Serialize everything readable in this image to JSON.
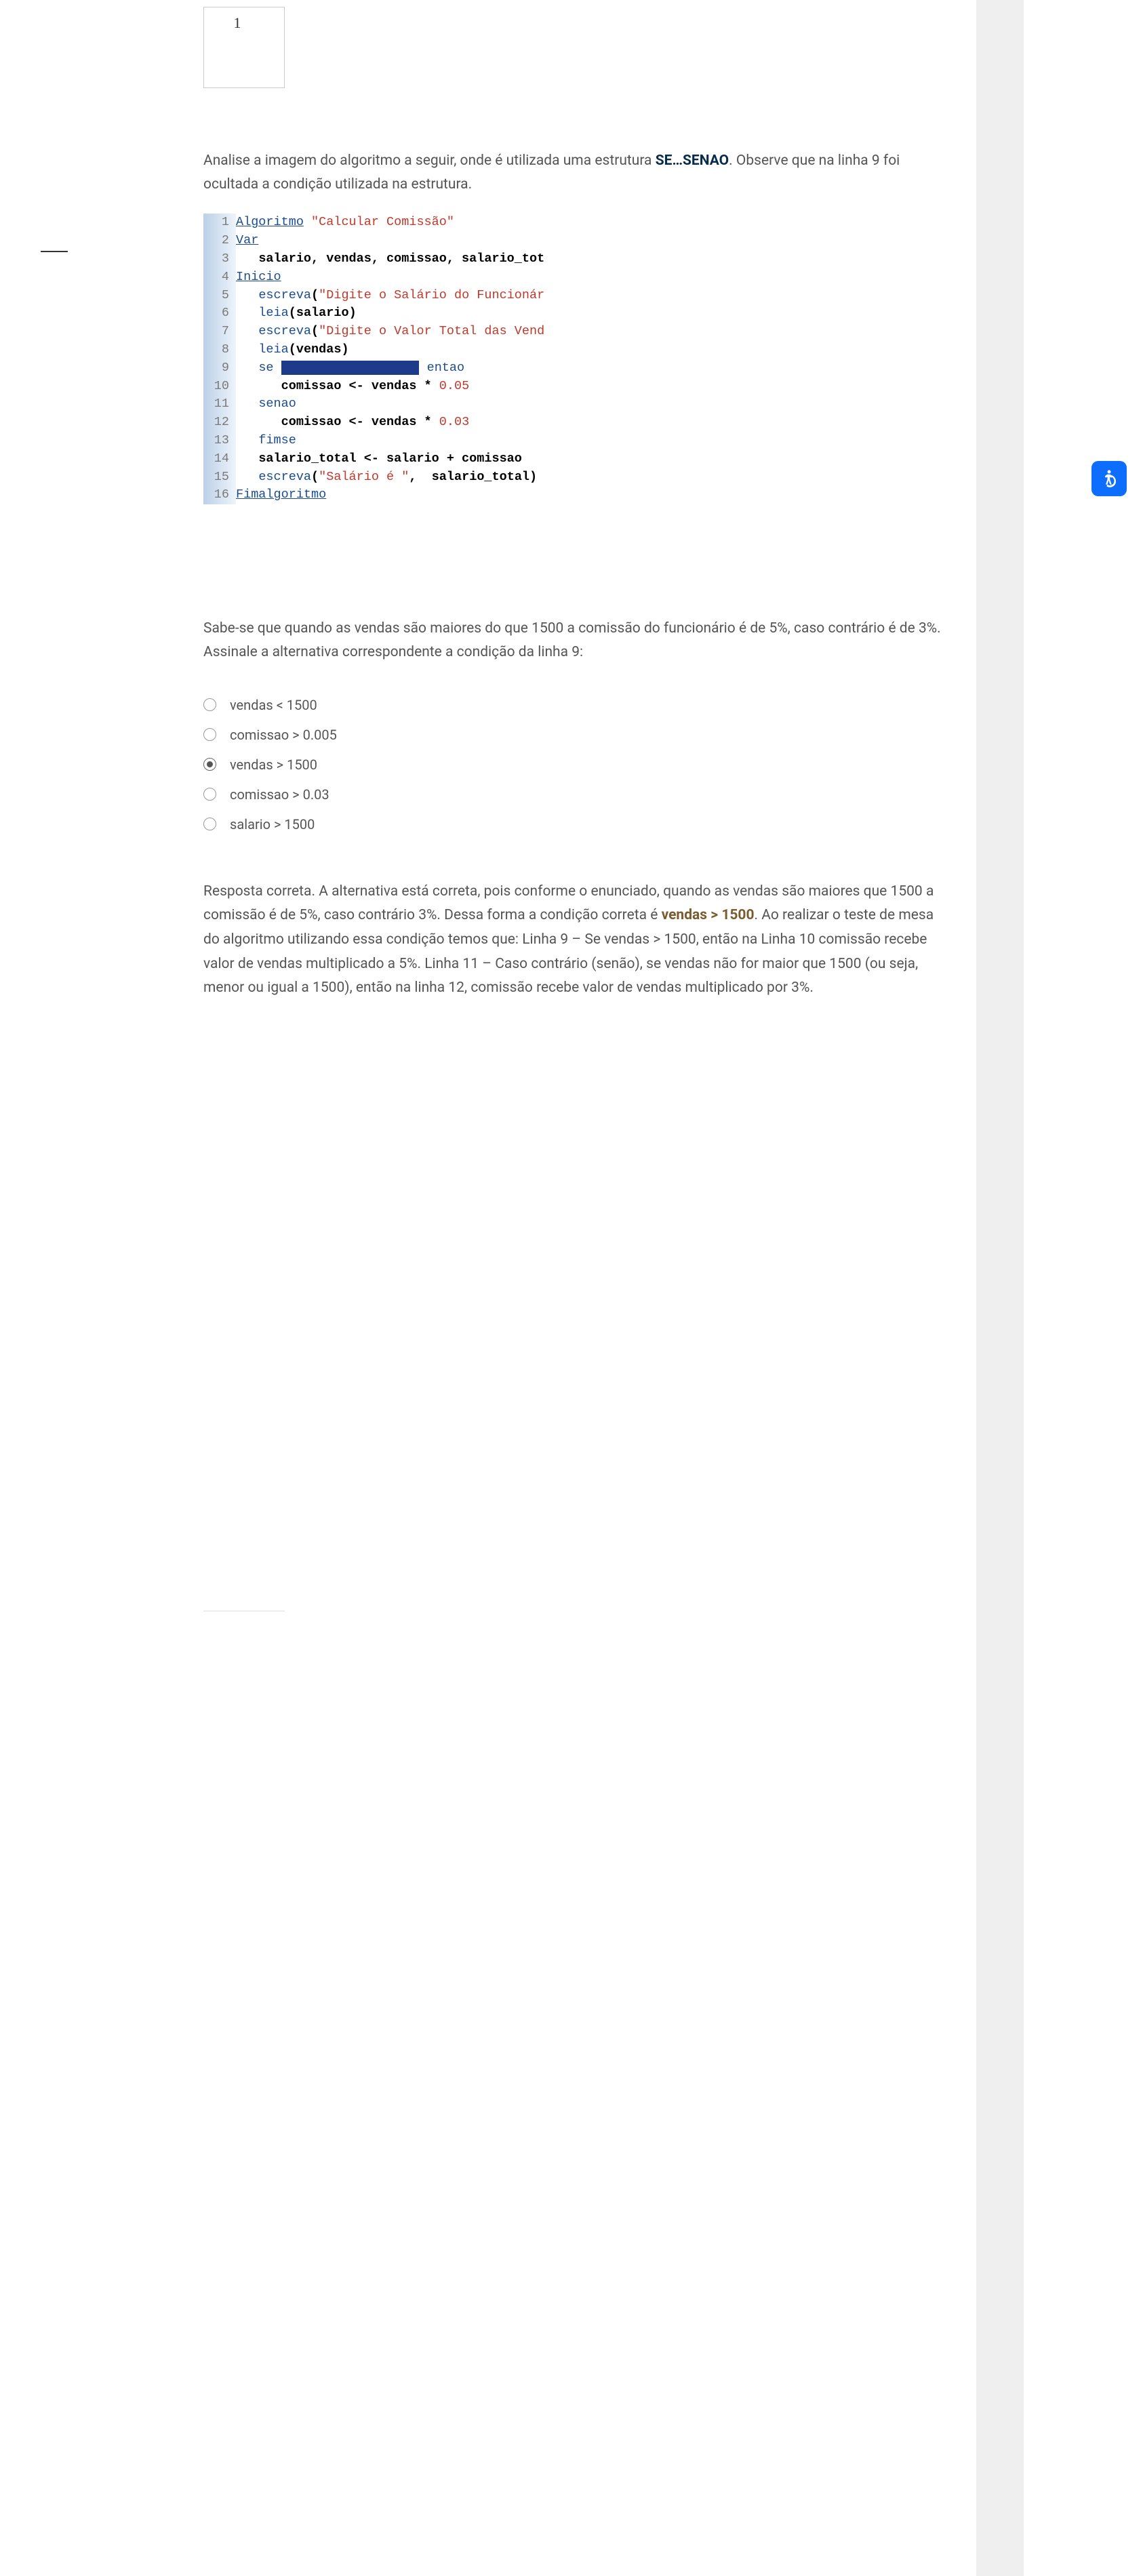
{
  "question_number": "1",
  "intro_parts": {
    "p1": "Analise a imagem do algoritmo a seguir, onde é utilizada uma estrutura",
    "kw": "SE…SENAO",
    "p2": ". Observe que na linha 9 foi ocultada a condição utilizada na estrutura."
  },
  "code": {
    "lines": [
      {
        "n": "1",
        "seg": [
          {
            "c": "u",
            "t": "Algoritmo"
          },
          {
            "c": "",
            "t": " "
          },
          {
            "c": "s",
            "t": "\"Calcular Comissão\""
          }
        ]
      },
      {
        "n": "2",
        "seg": [
          {
            "c": "u",
            "t": "Var"
          }
        ]
      },
      {
        "n": "3",
        "seg": [
          {
            "c": "",
            "t": "   "
          },
          {
            "c": "b",
            "t": "salario, vendas, comissao, salario_tot"
          }
        ]
      },
      {
        "n": "4",
        "seg": [
          {
            "c": "u",
            "t": "Inicio"
          }
        ]
      },
      {
        "n": "5",
        "seg": [
          {
            "c": "",
            "t": "   "
          },
          {
            "c": "k",
            "t": "escreva"
          },
          {
            "c": "p",
            "t": "("
          },
          {
            "c": "s",
            "t": "\"Digite o Salário do Funcionár"
          }
        ]
      },
      {
        "n": "6",
        "seg": [
          {
            "c": "",
            "t": "   "
          },
          {
            "c": "k",
            "t": "leia"
          },
          {
            "c": "p",
            "t": "("
          },
          {
            "c": "b",
            "t": "salario"
          },
          {
            "c": "p",
            "t": ")"
          }
        ]
      },
      {
        "n": "7",
        "seg": [
          {
            "c": "",
            "t": "   "
          },
          {
            "c": "k",
            "t": "escreva"
          },
          {
            "c": "p",
            "t": "("
          },
          {
            "c": "s",
            "t": "\"Digite o Valor Total das Vend"
          }
        ]
      },
      {
        "n": "8",
        "seg": [
          {
            "c": "",
            "t": "   "
          },
          {
            "c": "k",
            "t": "leia"
          },
          {
            "c": "p",
            "t": "("
          },
          {
            "c": "b",
            "t": "vendas"
          },
          {
            "c": "p",
            "t": ")"
          }
        ]
      },
      {
        "n": "9",
        "seg": [
          {
            "c": "",
            "t": "   "
          },
          {
            "c": "k",
            "t": "se"
          },
          {
            "c": "",
            "t": " "
          },
          {
            "c": "hl",
            "t": "                  "
          },
          {
            "c": "",
            "t": " "
          },
          {
            "c": "k",
            "t": "entao"
          }
        ]
      },
      {
        "n": "10",
        "seg": [
          {
            "c": "",
            "t": "      "
          },
          {
            "c": "b",
            "t": "comissao <- vendas * "
          },
          {
            "c": "n",
            "t": "0.05"
          }
        ]
      },
      {
        "n": "11",
        "seg": [
          {
            "c": "",
            "t": "   "
          },
          {
            "c": "k",
            "t": "senao"
          }
        ]
      },
      {
        "n": "12",
        "seg": [
          {
            "c": "",
            "t": "      "
          },
          {
            "c": "b",
            "t": "comissao <- vendas * "
          },
          {
            "c": "n",
            "t": "0.03"
          }
        ]
      },
      {
        "n": "13",
        "seg": [
          {
            "c": "",
            "t": "   "
          },
          {
            "c": "k",
            "t": "fimse"
          }
        ]
      },
      {
        "n": "14",
        "seg": [
          {
            "c": "",
            "t": "   "
          },
          {
            "c": "b",
            "t": "salario_total <- salario + comissao"
          }
        ]
      },
      {
        "n": "15",
        "seg": [
          {
            "c": "",
            "t": "   "
          },
          {
            "c": "k",
            "t": "escreva"
          },
          {
            "c": "p",
            "t": "("
          },
          {
            "c": "s",
            "t": "\"Salário é \""
          },
          {
            "c": "p",
            "t": ","
          },
          {
            "c": "",
            "t": "  "
          },
          {
            "c": "b",
            "t": "salario_total"
          },
          {
            "c": "p",
            "t": ")"
          }
        ]
      },
      {
        "n": "16",
        "seg": [
          {
            "c": "u",
            "t": "Fimalgoritmo"
          }
        ]
      }
    ]
  },
  "prompt": "Sabe-se que quando as vendas são maiores do que 1500 a comissão do funcionário é de 5%, caso contrário é de 3%. Assinale a alternativa correspondente a condição da linha 9:",
  "options": [
    {
      "label": "vendas < 1500",
      "selected": false
    },
    {
      "label": "comissao > 0.005",
      "selected": false
    },
    {
      "label": "vendas > 1500",
      "selected": true
    },
    {
      "label": "comissao > 0.03",
      "selected": false
    },
    {
      "label": "salario > 1500",
      "selected": false
    }
  ],
  "feedback": {
    "pre": "Resposta correta. A alternativa está correta, pois conforme o enunciado, quando as vendas são maiores que 1500 a comissão é de 5%, caso contrário 3%. Dessa forma a condição correta é ",
    "ans": "vendas > 1500",
    "post": ". Ao realizar o teste de mesa do algoritmo utilizando essa condição temos que: Linha 9 – Se vendas > 1500, então na Linha 10 comissão recebe valor de vendas multiplicado a 5%. Linha 11 – Caso contrário (senão), se vendas não for maior que 1500 (ou seja, menor ou igual a 1500), então na linha 12, comissão recebe valor de vendas multiplicado por 3%."
  }
}
